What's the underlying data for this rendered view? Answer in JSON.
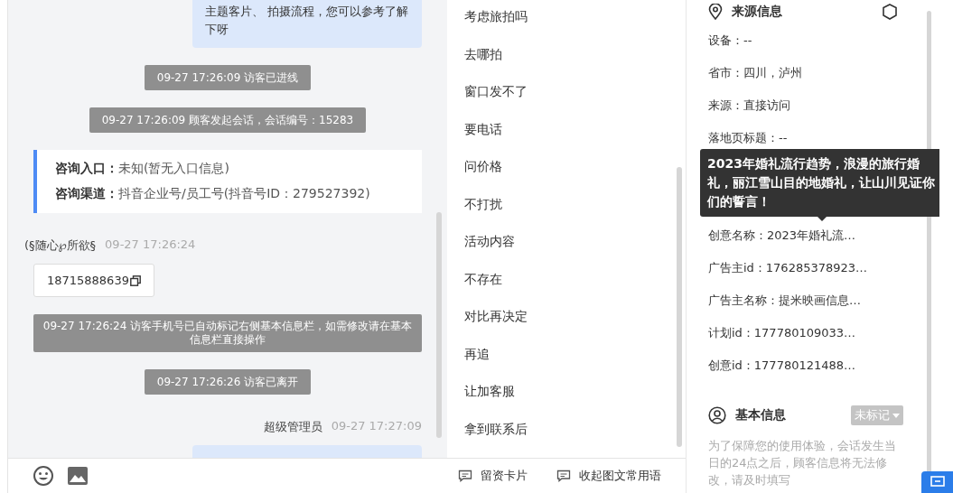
{
  "chat": {
    "messages": [
      {
        "kind": "bubble",
        "text": "主题客片、 拍摄流程，您可以参考了解下呀"
      },
      {
        "kind": "system",
        "text": "09-27 17:26:09 访客已进线"
      },
      {
        "kind": "system",
        "text": "09-27 17:26:09 顾客发起会话，会话编号：15283"
      },
      {
        "kind": "info",
        "rows": [
          {
            "label": "咨询入口：",
            "value": "未知(暂无入口信息)"
          },
          {
            "label": "咨询渠道：",
            "value": "抖音企业号/员工号(抖音号ID：279527392)"
          }
        ]
      },
      {
        "kind": "visitor",
        "name": "(§随心℘所欲§",
        "time": "09-27 17:26:24"
      },
      {
        "kind": "phone",
        "text": "18715888639"
      },
      {
        "kind": "system",
        "text": "09-27 17:26:24 访客手机号已自动标记右侧基本信息栏，如需修改请在基本信息栏直接操作"
      },
      {
        "kind": "system",
        "text": "09-27 17:26:26 访客已离开"
      },
      {
        "kind": "agent",
        "name": "超级管理员",
        "time": "09-27 17:27:09"
      },
      {
        "kind": "partial"
      }
    ]
  },
  "quick_replies": [
    {
      "label": "考虑旅拍吗"
    },
    {
      "label": "去哪拍"
    },
    {
      "label": "窗口发不了"
    },
    {
      "label": "要电话"
    },
    {
      "label": "问价格"
    },
    {
      "label": "不打扰"
    },
    {
      "label": "活动内容"
    },
    {
      "label": "不存在"
    },
    {
      "label": "对比再决定"
    },
    {
      "label": "再追"
    },
    {
      "label": "让加客服"
    },
    {
      "label": "拿到联系后"
    }
  ],
  "toolbar": {
    "buttons": [
      {
        "label": "留资卡片"
      },
      {
        "label": "收起图文常用语"
      }
    ]
  },
  "source_info": {
    "title": "来源信息",
    "rows": [
      "设备：--",
      "省市：四川，泸州",
      "来源：直接访问",
      "落地页标题：--",
      "创意名称：2023年婚礼流…",
      "广告主id：176285378923…",
      "广告主名称：提米映画信息…",
      "计划id：177780109033…",
      "创意id：177780121488…"
    ]
  },
  "tooltip": {
    "text": "2023年婚礼流行趋势，浪漫的旅行婚礼，丽江雪山目的地婚礼，让山川见证你们的誓言！"
  },
  "basic_info": {
    "title": "基本信息",
    "tag": "未标记",
    "note": "为了保障您的使用体验，会话发生当日的24点之后，顾客信息将无法修改，请及时填写"
  }
}
